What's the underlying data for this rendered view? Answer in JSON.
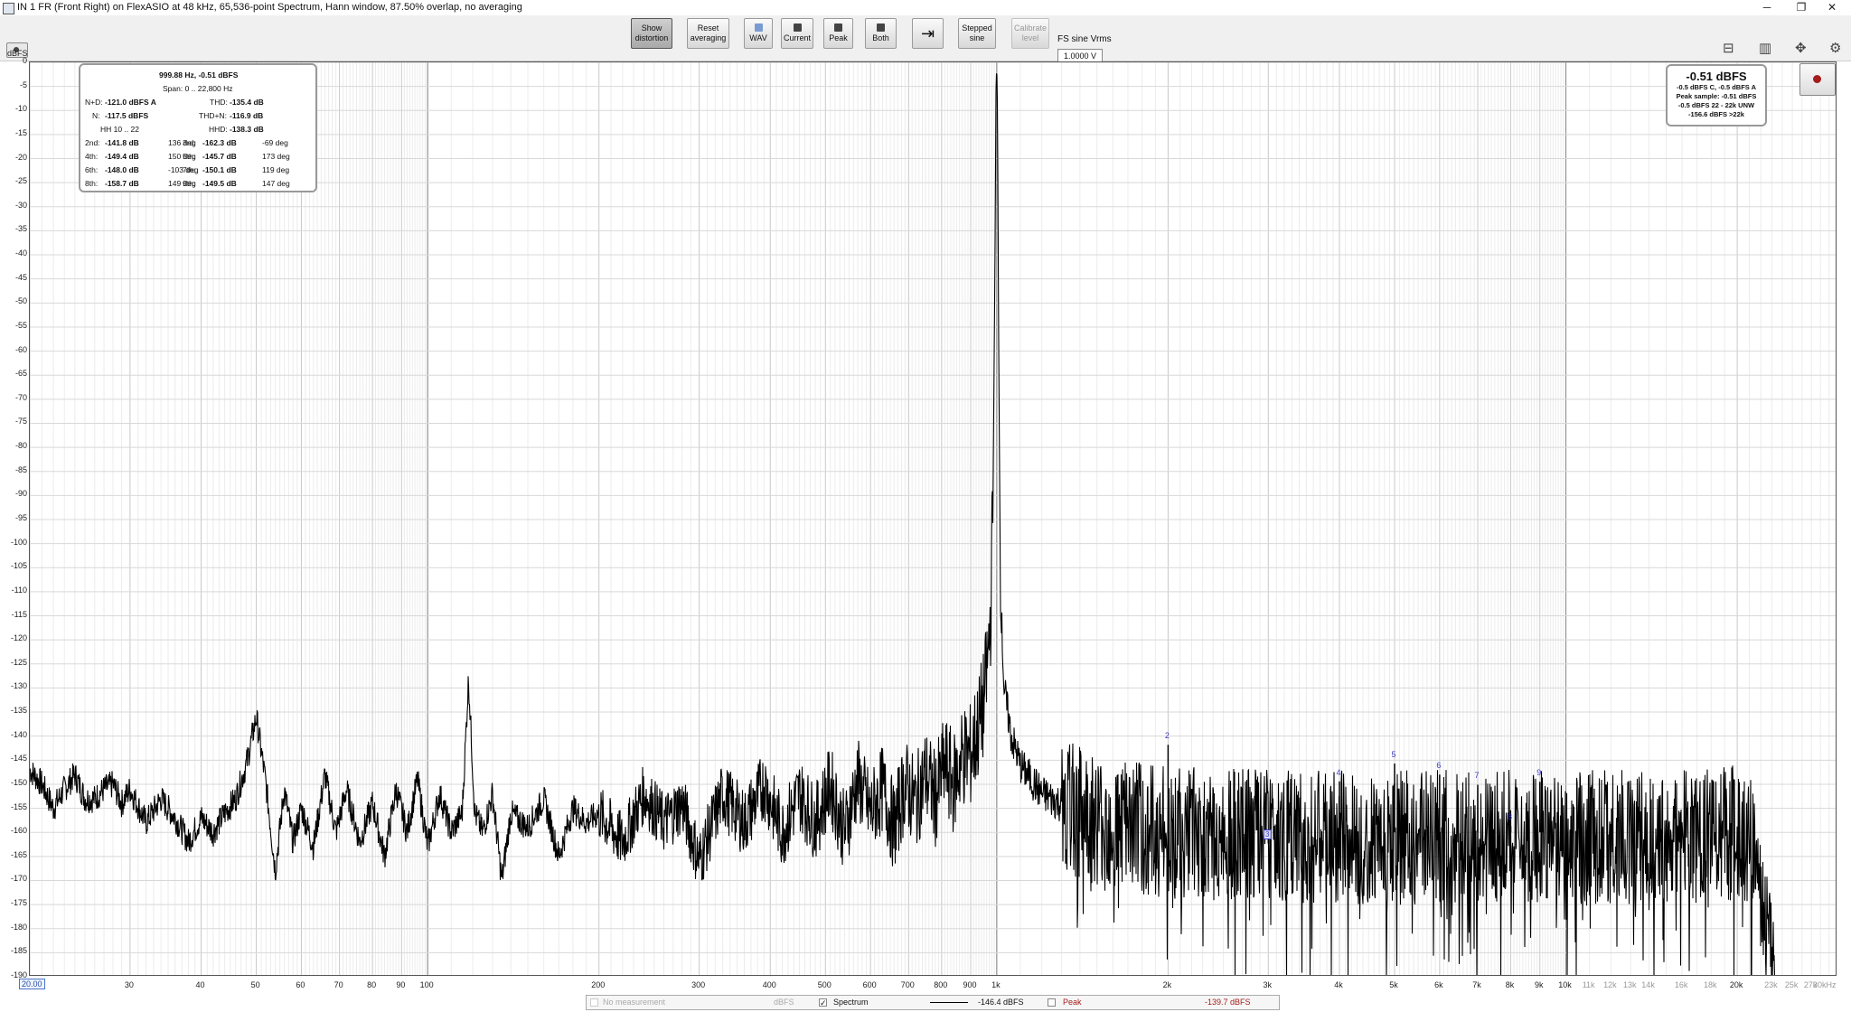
{
  "window": {
    "title": "IN 1 FR (Front Right) on FlexASIO at 48 kHz, 65,536-point Spectrum, Hann window, 87.50% overlap, no averaging",
    "controls": [
      "─",
      "❐",
      "✕"
    ]
  },
  "toolbar": {
    "show_distortion": "Show distortion",
    "reset_averaging": "Reset averaging",
    "wav": "WAV",
    "current": "Current",
    "peak": "Peak",
    "both": "Both",
    "stepped_sine": "Stepped sine",
    "calibrate_level": "Calibrate level",
    "fs_sine_label": "FS sine Vrms",
    "fs_sine_value": "1.0000 V"
  },
  "colors": {
    "accent": "#4a74c9",
    "trace": "#000000",
    "harmonic_label": "#3b3bbf",
    "peak_text": "#a41c1c"
  },
  "info_panel": {
    "header_freq": "999.88 Hz, -0.51 dBFS",
    "span": "Span: 0 .. 22,800 Hz",
    "nd_label": "N+D:",
    "nd_value": "-121.0 dBFS A",
    "thd_label": "THD:",
    "thd_value": "-135.4 dB",
    "n_label": "N:",
    "n_value": "-117.5 dBFS",
    "thdn_label": "THD+N:",
    "thdn_value": "-116.9 dB",
    "hh_label": "HH 10 .. 22",
    "hhd_label": "HHD:",
    "hhd_value": "-138.3 dB",
    "harmonics": [
      {
        "name": "2nd:",
        "db": "-141.8 dB",
        "deg": "136 deg"
      },
      {
        "name": "3rd:",
        "db": "-162.3 dB",
        "deg": "-69 deg"
      },
      {
        "name": "4th:",
        "db": "-149.4 dB",
        "deg": "150 deg"
      },
      {
        "name": "5th:",
        "db": "-145.7 dB",
        "deg": "173 deg"
      },
      {
        "name": "6th:",
        "db": "-148.0 dB",
        "deg": "-103 deg"
      },
      {
        "name": "7th:",
        "db": "-150.1 dB",
        "deg": "119 deg"
      },
      {
        "name": "8th:",
        "db": "-158.7 dB",
        "deg": "149 deg"
      },
      {
        "name": "9th:",
        "db": "-149.5 dB",
        "deg": "147 deg"
      }
    ]
  },
  "level_panel": {
    "main": "-0.51 dBFS",
    "line1": "-0.5 dBFS C, -0.5 dBFS A",
    "line2": "Peak sample: -0.51 dBFS",
    "line3": "-0.5 dBFS 22 - 22k UNW",
    "line4": "-156.6 dBFS >22k"
  },
  "legend": {
    "no_measurement": "No measurement",
    "unit": "dBFS",
    "spectrum": "Spectrum",
    "spectrum_value": "-146.4 dBFS",
    "peak": "Peak",
    "peak_value": "-139.7 dBFS",
    "spectrum_checked": "✓"
  },
  "chart_data": {
    "type": "line",
    "title": "",
    "xlabel": "",
    "ylabel": "dBFS",
    "x_scale": "log",
    "xlim": [
      20,
      30000
    ],
    "ylim": [
      -190,
      0
    ],
    "grid": true,
    "y_ticks": [
      "0",
      "-5",
      "-10",
      "-15",
      "-20",
      "-25",
      "-30",
      "-35",
      "-40",
      "-45",
      "-50",
      "-55",
      "-60",
      "-65",
      "-70",
      "-75",
      "-80",
      "-85",
      "-90",
      "-95",
      "-100",
      "-105",
      "-110",
      "-115",
      "-120",
      "-125",
      "-130",
      "-135",
      "-140",
      "-145",
      "-150",
      "-155",
      "-160",
      "-165",
      "-170",
      "-175",
      "-180",
      "-185",
      "-190"
    ],
    "x_ticks": [
      {
        "v": 20,
        "t": "20.00"
      },
      {
        "v": 30,
        "t": "30"
      },
      {
        "v": 40,
        "t": "40"
      },
      {
        "v": 50,
        "t": "50"
      },
      {
        "v": 60,
        "t": "60"
      },
      {
        "v": 70,
        "t": "70"
      },
      {
        "v": 80,
        "t": "80"
      },
      {
        "v": 90,
        "t": "90"
      },
      {
        "v": 100,
        "t": "100"
      },
      {
        "v": 200,
        "t": "200"
      },
      {
        "v": 300,
        "t": "300"
      },
      {
        "v": 400,
        "t": "400"
      },
      {
        "v": 500,
        "t": "500"
      },
      {
        "v": 600,
        "t": "600"
      },
      {
        "v": 700,
        "t": "700"
      },
      {
        "v": 800,
        "t": "800"
      },
      {
        "v": 900,
        "t": "900"
      },
      {
        "v": 1000,
        "t": "1k"
      },
      {
        "v": 2000,
        "t": "2k"
      },
      {
        "v": 3000,
        "t": "3k"
      },
      {
        "v": 4000,
        "t": "4k"
      },
      {
        "v": 5000,
        "t": "5k"
      },
      {
        "v": 6000,
        "t": "6k"
      },
      {
        "v": 7000,
        "t": "7k"
      },
      {
        "v": 8000,
        "t": "8k"
      },
      {
        "v": 9000,
        "t": "9k"
      },
      {
        "v": 10000,
        "t": "10k"
      },
      {
        "v": 11000,
        "t": "11k"
      },
      {
        "v": 12000,
        "t": "12k"
      },
      {
        "v": 13000,
        "t": "13k"
      },
      {
        "v": 14000,
        "t": "14k"
      },
      {
        "v": 16000,
        "t": "16k"
      },
      {
        "v": 18000,
        "t": "18k"
      },
      {
        "v": 20000,
        "t": "20k"
      },
      {
        "v": 23000,
        "t": "23k"
      },
      {
        "v": 25000,
        "t": "25k"
      },
      {
        "v": 27000,
        "t": "27k"
      },
      {
        "v": 30000,
        "t": "30kHz"
      }
    ],
    "series": [
      {
        "color": "#000000",
        "points": [
          [
            20,
            -147
          ],
          [
            21,
            -150
          ],
          [
            22,
            -155
          ],
          [
            23,
            -151
          ],
          [
            24,
            -148
          ],
          [
            25,
            -153
          ],
          [
            26,
            -153
          ],
          [
            27,
            -151
          ],
          [
            28,
            -150
          ],
          [
            29,
            -154
          ],
          [
            30,
            -151
          ],
          [
            32,
            -158
          ],
          [
            34,
            -153
          ],
          [
            36,
            -157
          ],
          [
            38,
            -162
          ],
          [
            40,
            -157
          ],
          [
            42,
            -160
          ],
          [
            44,
            -156
          ],
          [
            46,
            -153
          ],
          [
            48,
            -146
          ],
          [
            50,
            -136
          ],
          [
            52,
            -150
          ],
          [
            54,
            -168
          ],
          [
            56,
            -151
          ],
          [
            58,
            -162
          ],
          [
            60,
            -155
          ],
          [
            63,
            -163
          ],
          [
            66,
            -148
          ],
          [
            69,
            -160
          ],
          [
            72,
            -151
          ],
          [
            76,
            -162
          ],
          [
            80,
            -154
          ],
          [
            84,
            -165
          ],
          [
            88,
            -151
          ],
          [
            92,
            -160
          ],
          [
            96,
            -149
          ],
          [
            100,
            -163
          ],
          [
            105,
            -152
          ],
          [
            110,
            -160
          ],
          [
            115,
            -156
          ],
          [
            118,
            -128
          ],
          [
            121,
            -156
          ],
          [
            125,
            -160
          ],
          [
            130,
            -152
          ],
          [
            135,
            -170
          ],
          [
            140,
            -156
          ],
          [
            150,
            -159
          ],
          [
            160,
            -153
          ],
          [
            170,
            -165
          ],
          [
            180,
            -155
          ],
          [
            190,
            -158
          ],
          [
            200,
            -156
          ],
          [
            220,
            -162
          ],
          [
            240,
            -152
          ],
          [
            260,
            -158
          ],
          [
            280,
            -154
          ],
          [
            300,
            -166
          ],
          [
            330,
            -152
          ],
          [
            360,
            -158
          ],
          [
            390,
            -150
          ],
          [
            420,
            -160
          ],
          [
            450,
            -152
          ],
          [
            480,
            -158
          ],
          [
            510,
            -150
          ],
          [
            540,
            -160
          ],
          [
            570,
            -149
          ],
          [
            600,
            -156
          ],
          [
            630,
            -151
          ],
          [
            660,
            -159
          ],
          [
            690,
            -150
          ],
          [
            720,
            -154
          ],
          [
            750,
            -148
          ],
          [
            780,
            -153
          ],
          [
            810,
            -146
          ],
          [
            840,
            -150
          ],
          [
            870,
            -144
          ],
          [
            900,
            -144
          ],
          [
            930,
            -138
          ],
          [
            950,
            -133
          ],
          [
            965,
            -124
          ],
          [
            975,
            -115
          ],
          [
            985,
            -90
          ],
          [
            993,
            -40
          ],
          [
            997,
            -5
          ],
          [
            999.88,
            -0.51
          ],
          [
            1003,
            -10
          ],
          [
            1008,
            -60
          ],
          [
            1015,
            -110
          ],
          [
            1030,
            -130
          ],
          [
            1060,
            -140
          ],
          [
            1100,
            -146
          ],
          [
            1200,
            -152
          ],
          [
            1400,
            -156
          ],
          [
            1600,
            -158
          ],
          [
            2000,
            -160
          ],
          [
            3000,
            -161
          ],
          [
            5000,
            -161
          ],
          [
            8000,
            -161
          ],
          [
            12000,
            -161
          ],
          [
            16000,
            -161
          ],
          [
            20000,
            -160
          ],
          [
            21000,
            -161
          ],
          [
            22000,
            -172
          ],
          [
            23000,
            -188
          ],
          [
            23500,
            -190
          ]
        ]
      }
    ],
    "harmonic_markers": [
      {
        "label": "2",
        "freq": 2000,
        "db": -141.8
      },
      {
        "label": "3",
        "freq": 3000,
        "db": -162.3
      },
      {
        "label": "4",
        "freq": 4000,
        "db": -149.4
      },
      {
        "label": "5",
        "freq": 5000,
        "db": -145.7
      },
      {
        "label": "6",
        "freq": 6000,
        "db": -148.0
      },
      {
        "label": "7",
        "freq": 7000,
        "db": -150.1
      },
      {
        "label": "8",
        "freq": 8000,
        "db": -158.7
      },
      {
        "label": "9",
        "freq": 9000,
        "db": -149.5
      }
    ]
  }
}
